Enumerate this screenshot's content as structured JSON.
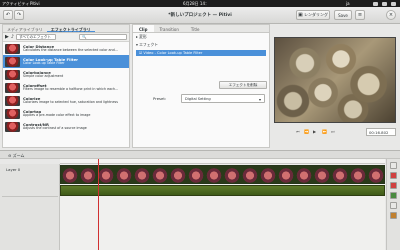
{
  "system_bar": {
    "activities": "アクティビティ",
    "app_name": "Pitivi",
    "clock": "6月28日 14：",
    "language": "ja"
  },
  "headerbar": {
    "title": "*新しいプロジェクト — Pitivi",
    "render_button": "レンダリング",
    "save_button": "Save"
  },
  "left_panel": {
    "tabs": [
      "メディアライブラリ",
      "エフェクトライブラリ"
    ],
    "active_tab": 1,
    "category_dropdown": "すべてのエフェクト",
    "effects": [
      {
        "name": "Color Distance",
        "desc": "Calculates the distance between the selected color and..."
      },
      {
        "name": "Color Look-up Table Filter",
        "desc": "Color Look-up Table Filter"
      },
      {
        "name": "Colorbalance",
        "desc": "Simple color adjustment"
      },
      {
        "name": "Coloroffset",
        "desc": "Filters image to resemble a halftone print in which each..."
      },
      {
        "name": "Colorize",
        "desc": "Colorizes image to selected hue, saturation and lightness"
      },
      {
        "name": "Colortap",
        "desc": "Applies a pre-made color effect to image"
      },
      {
        "name": "Contrast/NR",
        "desc": "Adjusts the contrast of a source image"
      }
    ],
    "selected_effect": 1
  },
  "clip_panel": {
    "tabs": [
      "Clip",
      "Transition",
      "Title"
    ],
    "active_tab": 0,
    "section_transform": "▸ 変形",
    "section_effects": "▾ エフェクト",
    "effect_row_label": "Video - Color Look-up Table Filter",
    "remove_effect_button": "エフェクトを削除",
    "preset_label": "Preset:",
    "preset_value": "Digital Setting"
  },
  "viewer": {
    "time_display": "00:16.802"
  },
  "timeline": {
    "zoom_label": "ズーム",
    "layer_label": "Layer 0"
  },
  "colors": {
    "selection": "#4a90d9",
    "playhead": "#d03030",
    "video_clip": "#3d5a2a",
    "audio_clip": "#4e6a22"
  }
}
